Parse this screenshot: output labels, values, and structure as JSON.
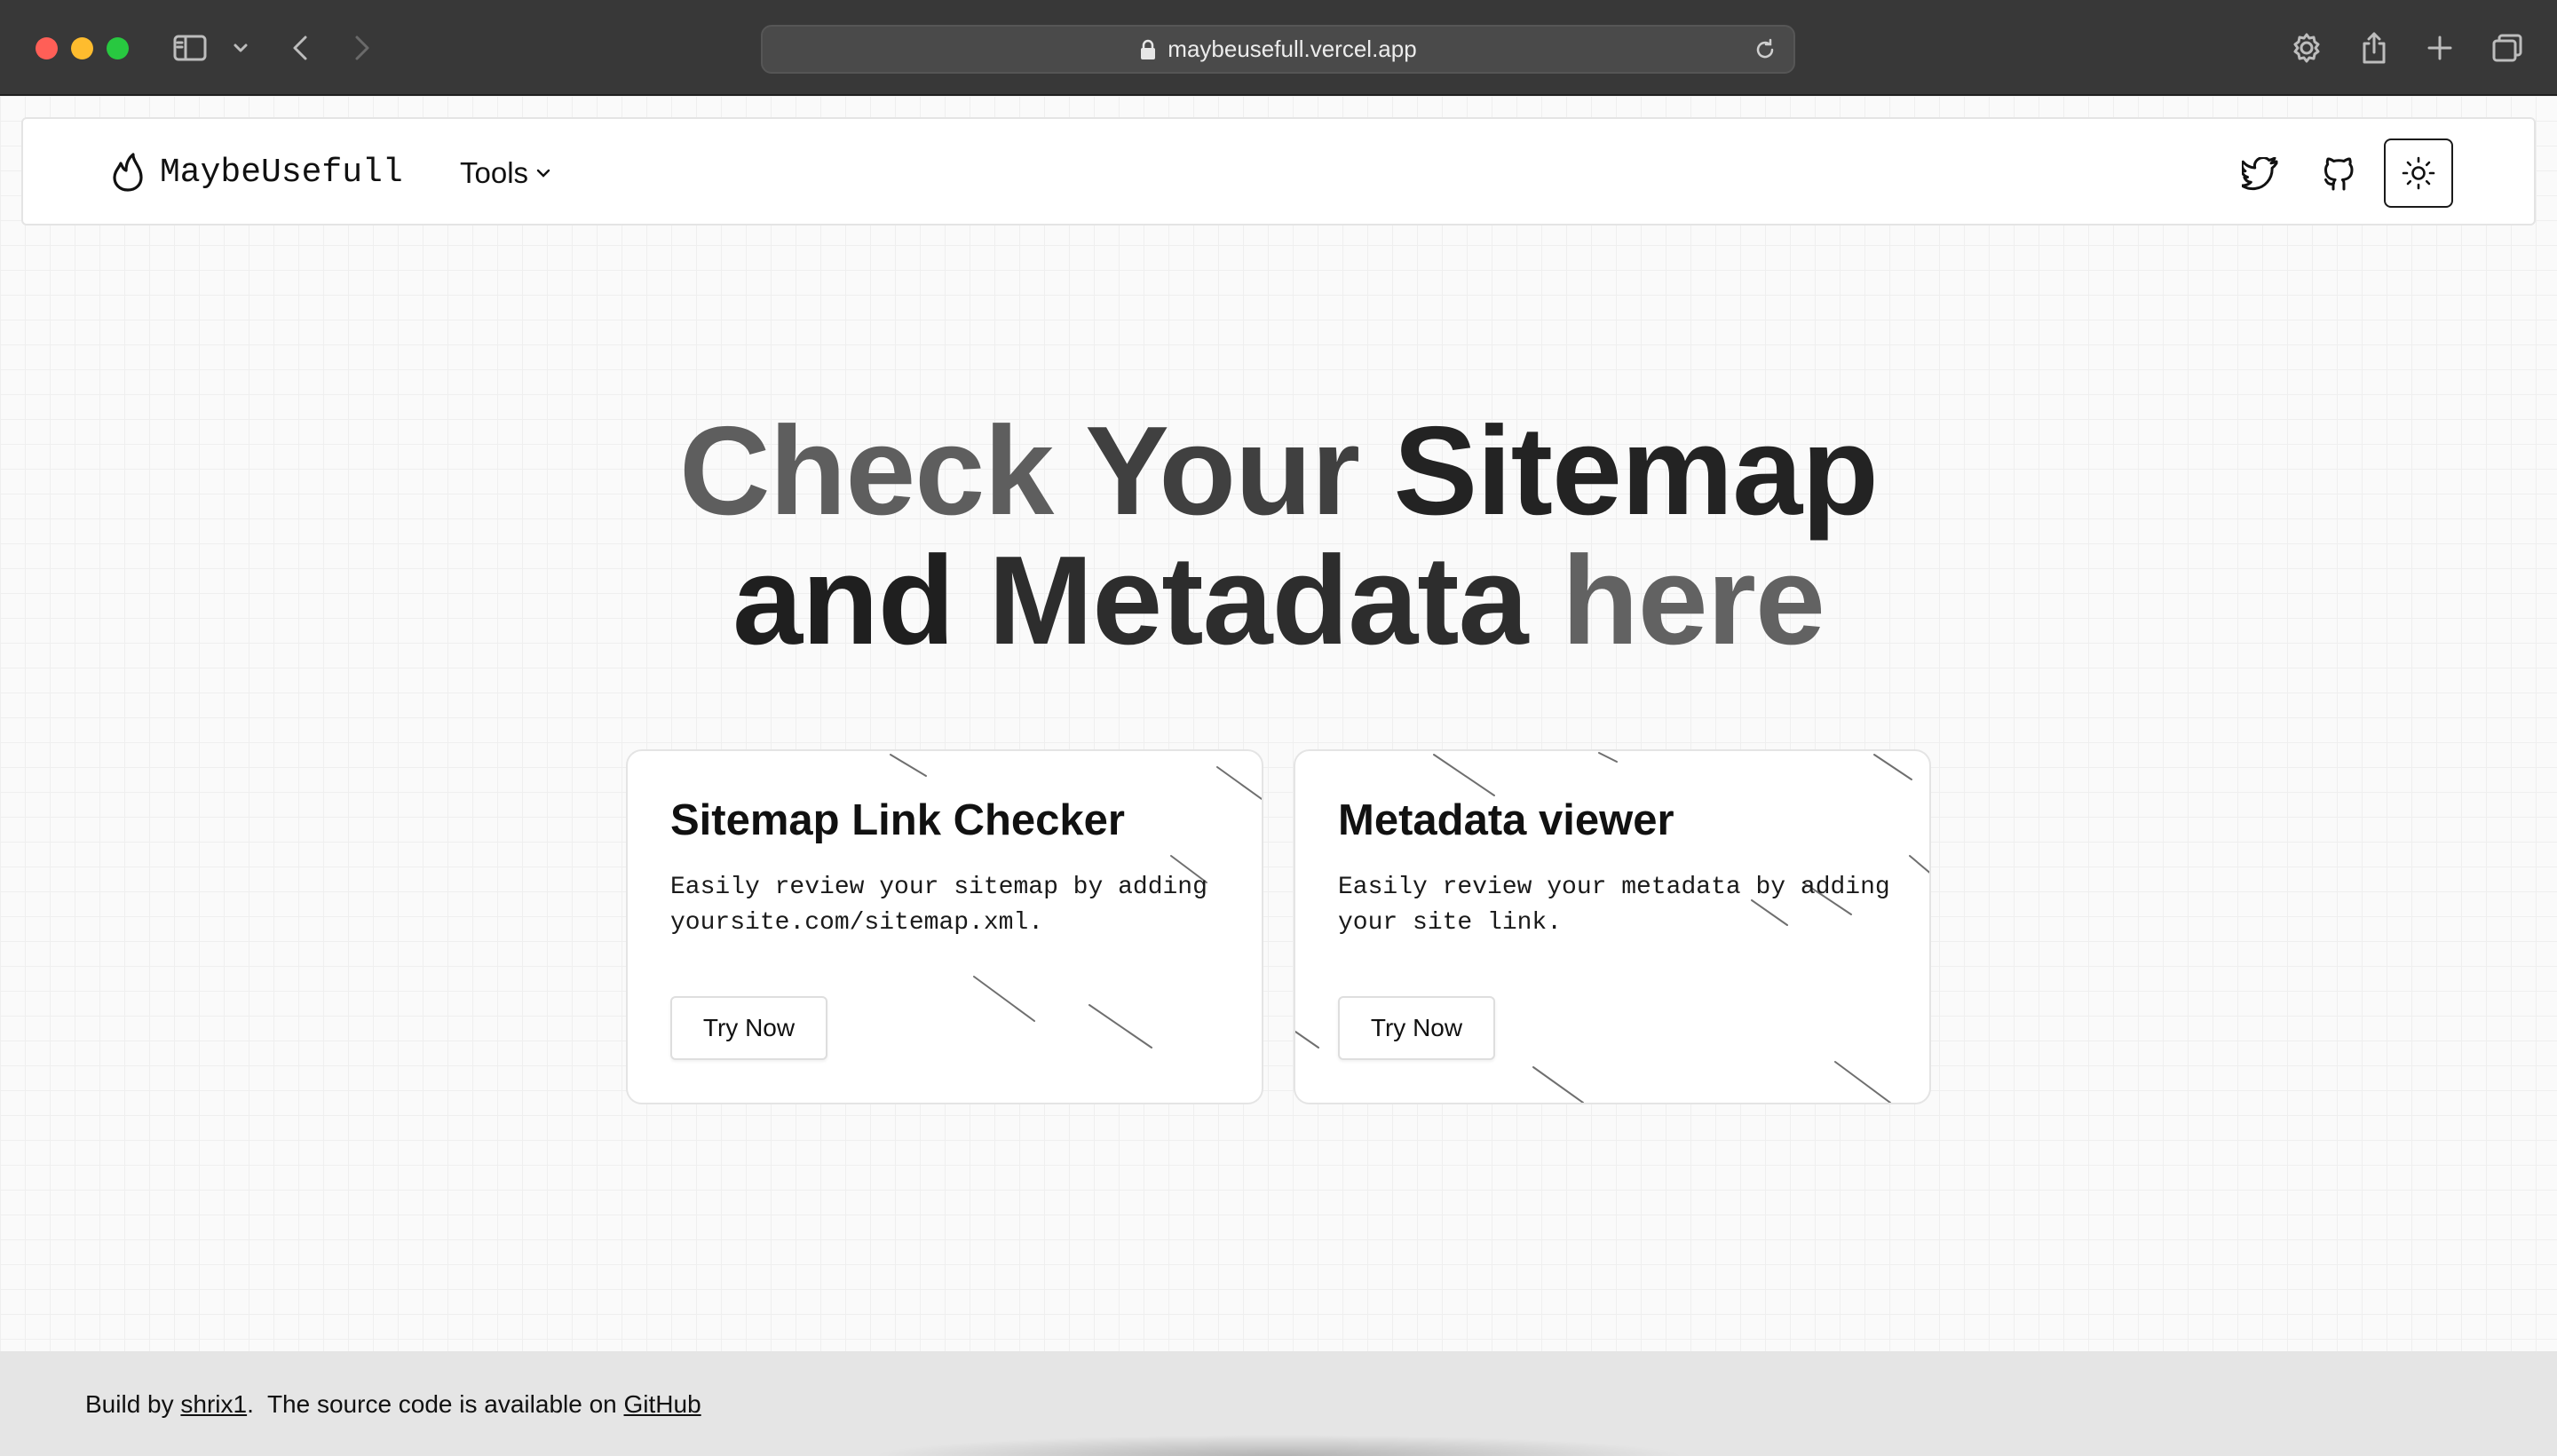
{
  "browser": {
    "url": "maybeusefull.vercel.app"
  },
  "nav": {
    "brand": "MaybeUsefull",
    "tools_label": "Tools"
  },
  "hero": {
    "line1": [
      "Check",
      "Your",
      "Sitemap"
    ],
    "line2": [
      "and",
      "Metadata",
      "here"
    ]
  },
  "cards": [
    {
      "title": "Sitemap Link Checker",
      "description": "Easily review your sitemap by adding yoursite.com/sitemap.xml.",
      "button": "Try Now"
    },
    {
      "title": "Metadata viewer",
      "description": "Easily review your metadata by adding your site link.",
      "button": "Try Now"
    }
  ],
  "footer": {
    "prefix": "Build by ",
    "author": "shrix1",
    "middle": ".  The source code is available on ",
    "source_link": "GitHub"
  },
  "icons": {
    "brand": "flame-icon",
    "twitter": "twitter-icon",
    "github": "github-icon",
    "theme": "sun-icon"
  }
}
